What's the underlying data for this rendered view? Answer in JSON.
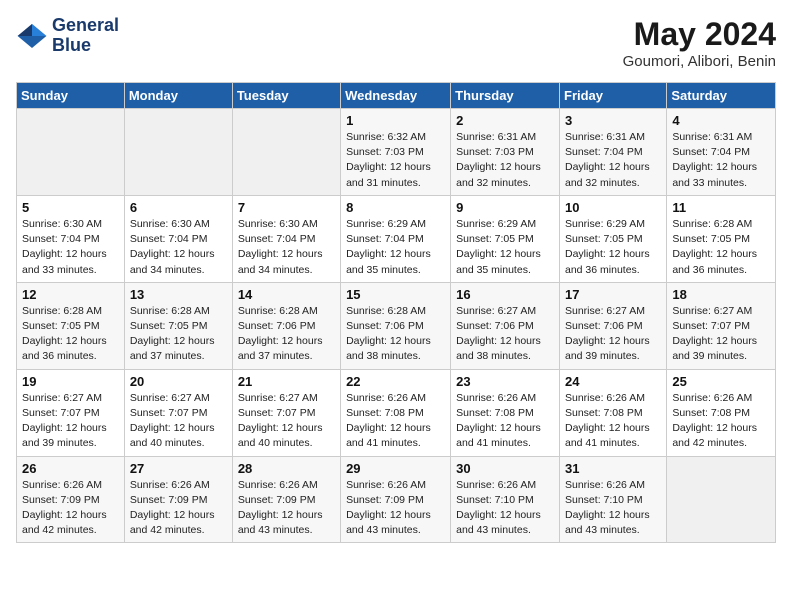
{
  "header": {
    "logo_line1": "General",
    "logo_line2": "Blue",
    "title": "May 2024",
    "subtitle": "Goumori, Alibori, Benin"
  },
  "days_of_week": [
    "Sunday",
    "Monday",
    "Tuesday",
    "Wednesday",
    "Thursday",
    "Friday",
    "Saturday"
  ],
  "weeks": [
    [
      {
        "day": "",
        "info": ""
      },
      {
        "day": "",
        "info": ""
      },
      {
        "day": "",
        "info": ""
      },
      {
        "day": "1",
        "info": "Sunrise: 6:32 AM\nSunset: 7:03 PM\nDaylight: 12 hours and 31 minutes."
      },
      {
        "day": "2",
        "info": "Sunrise: 6:31 AM\nSunset: 7:03 PM\nDaylight: 12 hours and 32 minutes."
      },
      {
        "day": "3",
        "info": "Sunrise: 6:31 AM\nSunset: 7:04 PM\nDaylight: 12 hours and 32 minutes."
      },
      {
        "day": "4",
        "info": "Sunrise: 6:31 AM\nSunset: 7:04 PM\nDaylight: 12 hours and 33 minutes."
      }
    ],
    [
      {
        "day": "5",
        "info": "Sunrise: 6:30 AM\nSunset: 7:04 PM\nDaylight: 12 hours and 33 minutes."
      },
      {
        "day": "6",
        "info": "Sunrise: 6:30 AM\nSunset: 7:04 PM\nDaylight: 12 hours and 34 minutes."
      },
      {
        "day": "7",
        "info": "Sunrise: 6:30 AM\nSunset: 7:04 PM\nDaylight: 12 hours and 34 minutes."
      },
      {
        "day": "8",
        "info": "Sunrise: 6:29 AM\nSunset: 7:04 PM\nDaylight: 12 hours and 35 minutes."
      },
      {
        "day": "9",
        "info": "Sunrise: 6:29 AM\nSunset: 7:05 PM\nDaylight: 12 hours and 35 minutes."
      },
      {
        "day": "10",
        "info": "Sunrise: 6:29 AM\nSunset: 7:05 PM\nDaylight: 12 hours and 36 minutes."
      },
      {
        "day": "11",
        "info": "Sunrise: 6:28 AM\nSunset: 7:05 PM\nDaylight: 12 hours and 36 minutes."
      }
    ],
    [
      {
        "day": "12",
        "info": "Sunrise: 6:28 AM\nSunset: 7:05 PM\nDaylight: 12 hours and 36 minutes."
      },
      {
        "day": "13",
        "info": "Sunrise: 6:28 AM\nSunset: 7:05 PM\nDaylight: 12 hours and 37 minutes."
      },
      {
        "day": "14",
        "info": "Sunrise: 6:28 AM\nSunset: 7:06 PM\nDaylight: 12 hours and 37 minutes."
      },
      {
        "day": "15",
        "info": "Sunrise: 6:28 AM\nSunset: 7:06 PM\nDaylight: 12 hours and 38 minutes."
      },
      {
        "day": "16",
        "info": "Sunrise: 6:27 AM\nSunset: 7:06 PM\nDaylight: 12 hours and 38 minutes."
      },
      {
        "day": "17",
        "info": "Sunrise: 6:27 AM\nSunset: 7:06 PM\nDaylight: 12 hours and 39 minutes."
      },
      {
        "day": "18",
        "info": "Sunrise: 6:27 AM\nSunset: 7:07 PM\nDaylight: 12 hours and 39 minutes."
      }
    ],
    [
      {
        "day": "19",
        "info": "Sunrise: 6:27 AM\nSunset: 7:07 PM\nDaylight: 12 hours and 39 minutes."
      },
      {
        "day": "20",
        "info": "Sunrise: 6:27 AM\nSunset: 7:07 PM\nDaylight: 12 hours and 40 minutes."
      },
      {
        "day": "21",
        "info": "Sunrise: 6:27 AM\nSunset: 7:07 PM\nDaylight: 12 hours and 40 minutes."
      },
      {
        "day": "22",
        "info": "Sunrise: 6:26 AM\nSunset: 7:08 PM\nDaylight: 12 hours and 41 minutes."
      },
      {
        "day": "23",
        "info": "Sunrise: 6:26 AM\nSunset: 7:08 PM\nDaylight: 12 hours and 41 minutes."
      },
      {
        "day": "24",
        "info": "Sunrise: 6:26 AM\nSunset: 7:08 PM\nDaylight: 12 hours and 41 minutes."
      },
      {
        "day": "25",
        "info": "Sunrise: 6:26 AM\nSunset: 7:08 PM\nDaylight: 12 hours and 42 minutes."
      }
    ],
    [
      {
        "day": "26",
        "info": "Sunrise: 6:26 AM\nSunset: 7:09 PM\nDaylight: 12 hours and 42 minutes."
      },
      {
        "day": "27",
        "info": "Sunrise: 6:26 AM\nSunset: 7:09 PM\nDaylight: 12 hours and 42 minutes."
      },
      {
        "day": "28",
        "info": "Sunrise: 6:26 AM\nSunset: 7:09 PM\nDaylight: 12 hours and 43 minutes."
      },
      {
        "day": "29",
        "info": "Sunrise: 6:26 AM\nSunset: 7:09 PM\nDaylight: 12 hours and 43 minutes."
      },
      {
        "day": "30",
        "info": "Sunrise: 6:26 AM\nSunset: 7:10 PM\nDaylight: 12 hours and 43 minutes."
      },
      {
        "day": "31",
        "info": "Sunrise: 6:26 AM\nSunset: 7:10 PM\nDaylight: 12 hours and 43 minutes."
      },
      {
        "day": "",
        "info": ""
      }
    ]
  ]
}
